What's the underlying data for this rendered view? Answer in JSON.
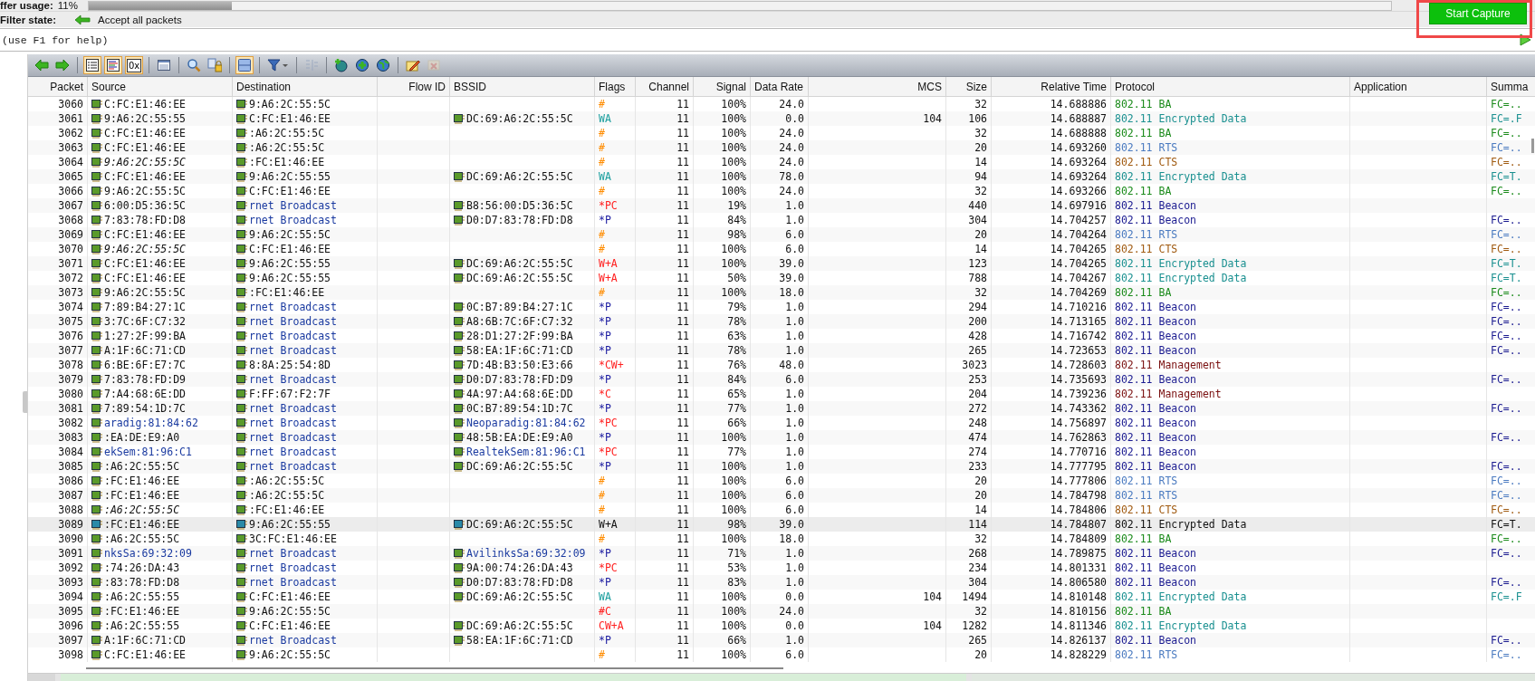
{
  "buffer": {
    "label": "ffer usage:",
    "value": "11%",
    "level": 0.11
  },
  "filter": {
    "label": "Filter state:",
    "value": "Accept all packets"
  },
  "capture_button": {
    "label": "Start Capture"
  },
  "command": {
    "value": "(use F1 for help)"
  },
  "toolbar": [
    [
      {
        "kind": "back",
        "selected": false,
        "disabled": false
      },
      {
        "kind": "forward",
        "selected": false,
        "disabled": false
      }
    ],
    [
      {
        "kind": "list",
        "selected": true,
        "disabled": false
      },
      {
        "kind": "colorlist",
        "selected": true,
        "disabled": false
      },
      {
        "kind": "hex",
        "label": "0x",
        "selected": true,
        "disabled": false
      }
    ],
    [
      {
        "kind": "window",
        "selected": false,
        "disabled": false
      }
    ],
    [
      {
        "kind": "search",
        "selected": false,
        "disabled": false
      },
      {
        "kind": "lock",
        "selected": false,
        "disabled": false
      }
    ],
    [
      {
        "kind": "panel",
        "selected": true,
        "disabled": false
      }
    ],
    [
      {
        "kind": "filter",
        "selected": false,
        "disabled": false
      }
    ],
    [
      {
        "kind": "columns",
        "selected": false,
        "disabled": true
      }
    ],
    [
      {
        "kind": "globe-add",
        "selected": false,
        "disabled": false
      },
      {
        "kind": "globe-plus",
        "selected": false,
        "disabled": false
      },
      {
        "kind": "globe",
        "selected": false,
        "disabled": false
      }
    ],
    [
      {
        "kind": "pencil",
        "selected": false,
        "disabled": false
      },
      {
        "kind": "erase",
        "selected": false,
        "disabled": true
      }
    ]
  ],
  "columns": [
    "Packet",
    "Source",
    "Destination",
    "Flow ID",
    "BSSID",
    "Flags",
    "Channel",
    "Signal",
    "Data Rate",
    "MCS",
    "Size",
    "Relative Time",
    "Protocol",
    "Application",
    "Summa"
  ],
  "rows": [
    {
      "no": "3060",
      "src": {
        "text": "C:FC:E1:46:EE",
        "kind": "plain"
      },
      "dst": {
        "text": "9:A6:2C:55:5C",
        "kind": "plain"
      },
      "flags": {
        "text": "#",
        "color": "#ff8c00"
      },
      "channel": "11",
      "signal": "100%",
      "rate": "24.0",
      "size": "32",
      "time": "14.688886",
      "kind": "ba",
      "protocol": "802.11 BA",
      "summary": "FC=..",
      "selected": false
    },
    {
      "no": "3061",
      "src": {
        "text": "9:A6:2C:55:55",
        "kind": "plain"
      },
      "dst": {
        "text": "C:FC:E1:46:EE",
        "kind": "plain"
      },
      "bssid": {
        "text": "DC:69:A6:2C:55:5C",
        "kind": "plain"
      },
      "flags": {
        "text": "WA",
        "color": "#1a9e9e"
      },
      "channel": "11",
      "signal": "100%",
      "rate": "0.0",
      "mcs": "104",
      "size": "106",
      "time": "14.688887",
      "kind": "data",
      "protocol": "802.11 Encrypted Data",
      "summary": "FC=.F",
      "selected": false
    },
    {
      "no": "3062",
      "src": {
        "text": "C:FC:E1:46:EE",
        "kind": "plain"
      },
      "dst": {
        "text": ":A6:2C:55:5C",
        "kind": "plain"
      },
      "flags": {
        "text": "#",
        "color": "#ff8c00"
      },
      "channel": "11",
      "signal": "100%",
      "rate": "24.0",
      "size": "32",
      "time": "14.688888",
      "kind": "ba",
      "protocol": "802.11 BA",
      "summary": "FC=..",
      "selected": false
    },
    {
      "no": "3063",
      "src": {
        "text": "C:FC:E1:46:EE",
        "kind": "plain"
      },
      "dst": {
        "text": ":A6:2C:55:5C",
        "kind": "plain"
      },
      "flags": {
        "text": "#",
        "color": "#ff8c00"
      },
      "channel": "11",
      "signal": "100%",
      "rate": "24.0",
      "size": "20",
      "time": "14.693260",
      "kind": "rts",
      "protocol": "802.11 RTS",
      "summary": "FC=..",
      "selected": false
    },
    {
      "no": "3064",
      "src": {
        "text": "9:A6:2C:55:5C",
        "kind": "italic"
      },
      "dst": {
        "text": ":FC:E1:46:EE",
        "kind": "plain"
      },
      "flags": {
        "text": "#",
        "color": "#ff8c00"
      },
      "channel": "11",
      "signal": "100%",
      "rate": "24.0",
      "size": "14",
      "time": "14.693264",
      "kind": "cts",
      "protocol": "802.11 CTS",
      "summary": "FC=..",
      "selected": false
    },
    {
      "no": "3065",
      "src": {
        "text": "C:FC:E1:46:EE",
        "kind": "plain"
      },
      "dst": {
        "text": "9:A6:2C:55:55",
        "kind": "plain"
      },
      "bssid": {
        "text": "DC:69:A6:2C:55:5C",
        "kind": "plain"
      },
      "flags": {
        "text": "WA",
        "color": "#1a9e9e"
      },
      "channel": "11",
      "signal": "100%",
      "rate": "78.0",
      "size": "94",
      "time": "14.693264",
      "kind": "data",
      "protocol": "802.11 Encrypted Data",
      "summary": "FC=T.",
      "selected": false
    },
    {
      "no": "3066",
      "src": {
        "text": "9:A6:2C:55:5C",
        "kind": "plain"
      },
      "dst": {
        "text": "C:FC:E1:46:EE",
        "kind": "plain"
      },
      "flags": {
        "text": "#",
        "color": "#ff8c00"
      },
      "channel": "11",
      "signal": "100%",
      "rate": "24.0",
      "size": "32",
      "time": "14.693266",
      "kind": "ba",
      "protocol": "802.11 BA",
      "summary": "FC=..",
      "selected": false
    },
    {
      "no": "3067",
      "src": {
        "text": "6:00:D5:36:5C",
        "kind": "plain"
      },
      "dst": {
        "text": "rnet Broadcast",
        "kind": "name"
      },
      "bssid": {
        "text": "B8:56:00:D5:36:5C",
        "kind": "plain"
      },
      "flags": {
        "text": "*PC",
        "color": "#ff2020"
      },
      "channel": "11",
      "signal": "19%",
      "rate": "1.0",
      "size": "440",
      "time": "14.697916",
      "kind": "beacon",
      "protocol": "802.11 Beacon",
      "selected": false
    },
    {
      "no": "3068",
      "src": {
        "text": "7:83:78:FD:D8",
        "kind": "plain"
      },
      "dst": {
        "text": "rnet Broadcast",
        "kind": "name"
      },
      "bssid": {
        "text": "D0:D7:83:78:FD:D8",
        "kind": "plain"
      },
      "flags": {
        "text": "*P",
        "color": "#1a1aa0"
      },
      "channel": "11",
      "signal": "84%",
      "rate": "1.0",
      "size": "304",
      "time": "14.704257",
      "kind": "beacon",
      "protocol": "802.11 Beacon",
      "summary": "FC=..",
      "selected": false
    },
    {
      "no": "3069",
      "src": {
        "text": "C:FC:E1:46:EE",
        "kind": "plain"
      },
      "dst": {
        "text": "9:A6:2C:55:5C",
        "kind": "plain"
      },
      "flags": {
        "text": "#",
        "color": "#ff8c00"
      },
      "channel": "11",
      "signal": "98%",
      "rate": "6.0",
      "size": "20",
      "time": "14.704264",
      "kind": "rts",
      "protocol": "802.11 RTS",
      "summary": "FC=..",
      "selected": false
    },
    {
      "no": "3070",
      "src": {
        "text": "9:A6:2C:55:5C",
        "kind": "italic"
      },
      "dst": {
        "text": "C:FC:E1:46:EE",
        "kind": "plain"
      },
      "flags": {
        "text": "#",
        "color": "#ff8c00"
      },
      "channel": "11",
      "signal": "100%",
      "rate": "6.0",
      "size": "14",
      "time": "14.704265",
      "kind": "cts",
      "protocol": "802.11 CTS",
      "summary": "FC=..",
      "selected": false
    },
    {
      "no": "3071",
      "src": {
        "text": "C:FC:E1:46:EE",
        "kind": "plain"
      },
      "dst": {
        "text": "9:A6:2C:55:55",
        "kind": "plain"
      },
      "bssid": {
        "text": "DC:69:A6:2C:55:5C",
        "kind": "plain"
      },
      "flags": {
        "text": "W+A",
        "color": "#ff2020"
      },
      "channel": "11",
      "signal": "100%",
      "rate": "39.0",
      "size": "123",
      "time": "14.704265",
      "kind": "data",
      "protocol": "802.11 Encrypted Data",
      "summary": "FC=T.",
      "selected": false
    },
    {
      "no": "3072",
      "src": {
        "text": "C:FC:E1:46:EE",
        "kind": "plain"
      },
      "dst": {
        "text": "9:A6:2C:55:55",
        "kind": "plain"
      },
      "bssid": {
        "text": "DC:69:A6:2C:55:5C",
        "kind": "plain"
      },
      "flags": {
        "text": "W+A",
        "color": "#ff2020"
      },
      "channel": "11",
      "signal": "50%",
      "rate": "39.0",
      "size": "788",
      "time": "14.704267",
      "kind": "data",
      "protocol": "802.11 Encrypted Data",
      "summary": "FC=T.",
      "selected": false
    },
    {
      "no": "3073",
      "src": {
        "text": "9:A6:2C:55:5C",
        "kind": "plain"
      },
      "dst": {
        "text": ":FC:E1:46:EE",
        "kind": "plain"
      },
      "flags": {
        "text": "#",
        "color": "#ff8c00"
      },
      "channel": "11",
      "signal": "100%",
      "rate": "18.0",
      "size": "32",
      "time": "14.704269",
      "kind": "ba",
      "protocol": "802.11 BA",
      "summary": "FC=..",
      "selected": false
    },
    {
      "no": "3074",
      "src": {
        "text": "7:89:B4:27:1C",
        "kind": "plain"
      },
      "dst": {
        "text": "rnet Broadcast",
        "kind": "name"
      },
      "bssid": {
        "text": "0C:B7:89:B4:27:1C",
        "kind": "plain"
      },
      "flags": {
        "text": "*P",
        "color": "#1a1aa0"
      },
      "channel": "11",
      "signal": "79%",
      "rate": "1.0",
      "size": "294",
      "time": "14.710216",
      "kind": "beacon",
      "protocol": "802.11 Beacon",
      "summary": "FC=..",
      "selected": false
    },
    {
      "no": "3075",
      "src": {
        "text": "3:7C:6F:C7:32",
        "kind": "plain"
      },
      "dst": {
        "text": "rnet Broadcast",
        "kind": "name"
      },
      "bssid": {
        "text": "A8:6B:7C:6F:C7:32",
        "kind": "plain"
      },
      "flags": {
        "text": "*P",
        "color": "#1a1aa0"
      },
      "channel": "11",
      "signal": "78%",
      "rate": "1.0",
      "size": "200",
      "time": "14.713165",
      "kind": "beacon",
      "protocol": "802.11 Beacon",
      "summary": "FC=..",
      "selected": false
    },
    {
      "no": "3076",
      "src": {
        "text": "1:27:2F:99:BA",
        "kind": "plain"
      },
      "dst": {
        "text": "rnet Broadcast",
        "kind": "name"
      },
      "bssid": {
        "text": "28:D1:27:2F:99:BA",
        "kind": "plain"
      },
      "flags": {
        "text": "*P",
        "color": "#1a1aa0"
      },
      "channel": "11",
      "signal": "63%",
      "rate": "1.0",
      "size": "428",
      "time": "14.716742",
      "kind": "beacon",
      "protocol": "802.11 Beacon",
      "summary": "FC=..",
      "selected": false
    },
    {
      "no": "3077",
      "src": {
        "text": "A:1F:6C:71:CD",
        "kind": "plain"
      },
      "dst": {
        "text": "rnet Broadcast",
        "kind": "name"
      },
      "bssid": {
        "text": "58:EA:1F:6C:71:CD",
        "kind": "plain"
      },
      "flags": {
        "text": "*P",
        "color": "#1a1aa0"
      },
      "channel": "11",
      "signal": "78%",
      "rate": "1.0",
      "size": "265",
      "time": "14.723653",
      "kind": "beacon",
      "protocol": "802.11 Beacon",
      "summary": "FC=..",
      "selected": false
    },
    {
      "no": "3078",
      "src": {
        "text": "6:BE:6F:E7:7C",
        "kind": "plain"
      },
      "dst": {
        "text": "8:8A:25:54:8D",
        "kind": "plain"
      },
      "bssid": {
        "text": "7D:4B:B3:50:E3:66",
        "kind": "plain"
      },
      "flags": {
        "text": "*CW+",
        "color": "#ff2020"
      },
      "channel": "11",
      "signal": "76%",
      "rate": "48.0",
      "size": "3023",
      "time": "14.728603",
      "kind": "mgmt",
      "protocol": "802.11 Management",
      "selected": false
    },
    {
      "no": "3079",
      "src": {
        "text": "7:83:78:FD:D9",
        "kind": "plain"
      },
      "dst": {
        "text": "rnet Broadcast",
        "kind": "name"
      },
      "bssid": {
        "text": "D0:D7:83:78:FD:D9",
        "kind": "plain"
      },
      "flags": {
        "text": "*P",
        "color": "#1a1aa0"
      },
      "channel": "11",
      "signal": "84%",
      "rate": "6.0",
      "size": "253",
      "time": "14.735693",
      "kind": "beacon",
      "protocol": "802.11 Beacon",
      "summary": "FC=..",
      "selected": false
    },
    {
      "no": "3080",
      "src": {
        "text": "7:A4:68:6E:DD",
        "kind": "plain"
      },
      "dst": {
        "text": "F:FF:67:F2:7F",
        "kind": "plain"
      },
      "bssid": {
        "text": "4A:97:A4:68:6E:DD",
        "kind": "plain"
      },
      "flags": {
        "text": "*C",
        "color": "#ff2020"
      },
      "channel": "11",
      "signal": "65%",
      "rate": "1.0",
      "size": "204",
      "time": "14.739236",
      "kind": "mgmt",
      "protocol": "802.11 Management",
      "selected": false
    },
    {
      "no": "3081",
      "src": {
        "text": "7:89:54:1D:7C",
        "kind": "plain"
      },
      "dst": {
        "text": "rnet Broadcast",
        "kind": "name"
      },
      "bssid": {
        "text": "0C:B7:89:54:1D:7C",
        "kind": "plain"
      },
      "flags": {
        "text": "*P",
        "color": "#1a1aa0"
      },
      "channel": "11",
      "signal": "77%",
      "rate": "1.0",
      "size": "272",
      "time": "14.743362",
      "kind": "beacon",
      "protocol": "802.11 Beacon",
      "summary": "FC=..",
      "selected": false
    },
    {
      "no": "3082",
      "src": {
        "text": "aradig:81:84:62",
        "kind": "name"
      },
      "dst": {
        "text": "rnet Broadcast",
        "kind": "name"
      },
      "bssid": {
        "text": "Neoparadig:81:84:62",
        "kind": "name"
      },
      "flags": {
        "text": "*PC",
        "color": "#ff2020"
      },
      "channel": "11",
      "signal": "66%",
      "rate": "1.0",
      "size": "248",
      "time": "14.756897",
      "kind": "beacon",
      "protocol": "802.11 Beacon",
      "selected": false
    },
    {
      "no": "3083",
      "src": {
        "text": ":EA:DE:E9:A0",
        "kind": "plain"
      },
      "dst": {
        "text": "rnet Broadcast",
        "kind": "name"
      },
      "bssid": {
        "text": "48:5B:EA:DE:E9:A0",
        "kind": "plain"
      },
      "flags": {
        "text": "*P",
        "color": "#1a1aa0"
      },
      "channel": "11",
      "signal": "100%",
      "rate": "1.0",
      "size": "474",
      "time": "14.762863",
      "kind": "beacon",
      "protocol": "802.11 Beacon",
      "summary": "FC=..",
      "selected": false
    },
    {
      "no": "3084",
      "src": {
        "text": "ekSem:81:96:C1",
        "kind": "name"
      },
      "dst": {
        "text": "rnet Broadcast",
        "kind": "name"
      },
      "bssid": {
        "text": "RealtekSem:81:96:C1",
        "kind": "name"
      },
      "flags": {
        "text": "*PC",
        "color": "#ff2020"
      },
      "channel": "11",
      "signal": "77%",
      "rate": "1.0",
      "size": "274",
      "time": "14.770716",
      "kind": "beacon",
      "protocol": "802.11 Beacon",
      "selected": false
    },
    {
      "no": "3085",
      "src": {
        "text": ":A6:2C:55:5C",
        "kind": "plain"
      },
      "dst": {
        "text": "rnet Broadcast",
        "kind": "name"
      },
      "bssid": {
        "text": "DC:69:A6:2C:55:5C",
        "kind": "plain"
      },
      "flags": {
        "text": "*P",
        "color": "#1a1aa0"
      },
      "channel": "11",
      "signal": "100%",
      "rate": "1.0",
      "size": "233",
      "time": "14.777795",
      "kind": "beacon",
      "protocol": "802.11 Beacon",
      "summary": "FC=..",
      "selected": false
    },
    {
      "no": "3086",
      "src": {
        "text": ":FC:E1:46:EE",
        "kind": "plain"
      },
      "dst": {
        "text": ":A6:2C:55:5C",
        "kind": "plain"
      },
      "flags": {
        "text": "#",
        "color": "#ff8c00"
      },
      "channel": "11",
      "signal": "100%",
      "rate": "6.0",
      "size": "20",
      "time": "14.777806",
      "kind": "rts",
      "protocol": "802.11 RTS",
      "summary": "FC=..",
      "selected": false
    },
    {
      "no": "3087",
      "src": {
        "text": ":FC:E1:46:EE",
        "kind": "plain"
      },
      "dst": {
        "text": ":A6:2C:55:5C",
        "kind": "plain"
      },
      "flags": {
        "text": "#",
        "color": "#ff8c00"
      },
      "channel": "11",
      "signal": "100%",
      "rate": "6.0",
      "size": "20",
      "time": "14.784798",
      "kind": "rts",
      "protocol": "802.11 RTS",
      "summary": "FC=..",
      "selected": false
    },
    {
      "no": "3088",
      "src": {
        "text": ":A6:2C:55:5C",
        "kind": "italic"
      },
      "dst": {
        "text": ":FC:E1:46:EE",
        "kind": "plain"
      },
      "flags": {
        "text": "#",
        "color": "#ff8c00"
      },
      "channel": "11",
      "signal": "100%",
      "rate": "6.0",
      "size": "14",
      "time": "14.784806",
      "kind": "cts",
      "protocol": "802.11 CTS",
      "summary": "FC=..",
      "selected": false
    },
    {
      "no": "3089",
      "src": {
        "text": ":FC:E1:46:EE",
        "kind": "plain"
      },
      "dst": {
        "text": "9:A6:2C:55:55",
        "kind": "plain"
      },
      "bssid": {
        "text": "DC:69:A6:2C:55:5C",
        "kind": "plain"
      },
      "flags": {
        "text": "W+A"
      },
      "channel": "11",
      "signal": "98%",
      "rate": "39.0",
      "size": "114",
      "time": "14.784807",
      "protocol": "802.11 Encrypted Data",
      "summary": "FC=T.",
      "selected": true
    },
    {
      "no": "3090",
      "src": {
        "text": ":A6:2C:55:5C",
        "kind": "plain"
      },
      "dst": {
        "text": "3C:FC:E1:46:EE",
        "kind": "plain"
      },
      "flags": {
        "text": "#",
        "color": "#ff8c00"
      },
      "channel": "11",
      "signal": "100%",
      "rate": "18.0",
      "size": "32",
      "time": "14.784809",
      "kind": "ba",
      "protocol": "802.11 BA",
      "summary": "FC=..",
      "selected": false
    },
    {
      "no": "3091",
      "src": {
        "text": "nksSa:69:32:09",
        "kind": "name"
      },
      "dst": {
        "text": "rnet Broadcast",
        "kind": "name"
      },
      "bssid": {
        "text": "AvilinksSa:69:32:09",
        "kind": "name"
      },
      "flags": {
        "text": "*P",
        "color": "#1a1aa0"
      },
      "channel": "11",
      "signal": "71%",
      "rate": "1.0",
      "size": "268",
      "time": "14.789875",
      "kind": "beacon",
      "protocol": "802.11 Beacon",
      "summary": "FC=..",
      "selected": false
    },
    {
      "no": "3092",
      "src": {
        "text": ":74:26:DA:43",
        "kind": "plain"
      },
      "dst": {
        "text": "rnet Broadcast",
        "kind": "name"
      },
      "bssid": {
        "text": "9A:00:74:26:DA:43",
        "kind": "plain"
      },
      "flags": {
        "text": "*PC",
        "color": "#ff2020"
      },
      "channel": "11",
      "signal": "53%",
      "rate": "1.0",
      "size": "234",
      "time": "14.801331",
      "kind": "beacon",
      "protocol": "802.11 Beacon",
      "selected": false
    },
    {
      "no": "3093",
      "src": {
        "text": ":83:78:FD:D8",
        "kind": "plain"
      },
      "dst": {
        "text": "rnet Broadcast",
        "kind": "name"
      },
      "bssid": {
        "text": "D0:D7:83:78:FD:D8",
        "kind": "plain"
      },
      "flags": {
        "text": "*P",
        "color": "#1a1aa0"
      },
      "channel": "11",
      "signal": "83%",
      "rate": "1.0",
      "size": "304",
      "time": "14.806580",
      "kind": "beacon",
      "protocol": "802.11 Beacon",
      "summary": "FC=..",
      "selected": false
    },
    {
      "no": "3094",
      "src": {
        "text": ":A6:2C:55:55",
        "kind": "plain"
      },
      "dst": {
        "text": "C:FC:E1:46:EE",
        "kind": "plain"
      },
      "bssid": {
        "text": "DC:69:A6:2C:55:5C",
        "kind": "plain"
      },
      "flags": {
        "text": "WA",
        "color": "#1a9e9e"
      },
      "channel": "11",
      "signal": "100%",
      "rate": "0.0",
      "mcs": "104",
      "size": "1494",
      "time": "14.810148",
      "kind": "data",
      "protocol": "802.11 Encrypted Data",
      "summary": "FC=.F",
      "selected": false
    },
    {
      "no": "3095",
      "src": {
        "text": ":FC:E1:46:EE",
        "kind": "plain"
      },
      "dst": {
        "text": "9:A6:2C:55:5C",
        "kind": "plain"
      },
      "flags": {
        "text": "#C",
        "color": "#ff2020"
      },
      "channel": "11",
      "signal": "100%",
      "rate": "24.0",
      "size": "32",
      "time": "14.810156",
      "kind": "ba",
      "protocol": "802.11 BA",
      "selected": false
    },
    {
      "no": "3096",
      "src": {
        "text": ":A6:2C:55:55",
        "kind": "plain"
      },
      "dst": {
        "text": "C:FC:E1:46:EE",
        "kind": "plain"
      },
      "bssid": {
        "text": "DC:69:A6:2C:55:5C",
        "kind": "plain"
      },
      "flags": {
        "text": "CW+A",
        "color": "#ff2020"
      },
      "channel": "11",
      "signal": "100%",
      "rate": "0.0",
      "mcs": "104",
      "size": "1282",
      "time": "14.811346",
      "kind": "data",
      "protocol": "802.11 Encrypted Data",
      "selected": false
    },
    {
      "no": "3097",
      "src": {
        "text": "A:1F:6C:71:CD",
        "kind": "plain"
      },
      "dst": {
        "text": "rnet Broadcast",
        "kind": "name"
      },
      "bssid": {
        "text": "58:EA:1F:6C:71:CD",
        "kind": "plain"
      },
      "flags": {
        "text": "*P",
        "color": "#1a1aa0"
      },
      "channel": "11",
      "signal": "66%",
      "rate": "1.0",
      "size": "265",
      "time": "14.826137",
      "kind": "beacon",
      "protocol": "802.11 Beacon",
      "summary": "FC=..",
      "selected": false
    },
    {
      "no": "3098",
      "src": {
        "text": "C:FC:E1:46:EE",
        "kind": "plain"
      },
      "dst": {
        "text": "9:A6:2C:55:5C",
        "kind": "plain"
      },
      "flags": {
        "text": "#",
        "color": "#ff8c00"
      },
      "channel": "11",
      "signal": "100%",
      "rate": "6.0",
      "size": "20",
      "time": "14.828229",
      "kind": "rts",
      "protocol": "802.11 RTS",
      "summary": "FC=..",
      "selected": false
    }
  ]
}
